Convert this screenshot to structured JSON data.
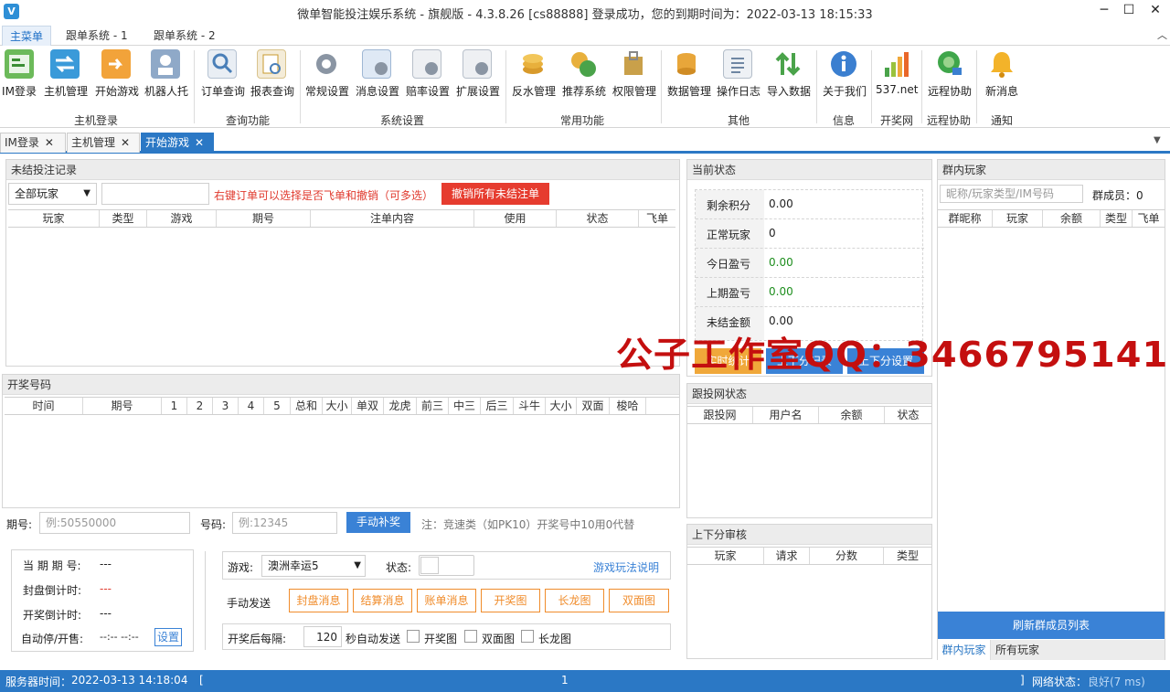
{
  "window": {
    "title": "微单智能投注娱乐系统 - 旗舰版 - 4.3.8.26    [cs88888] 登录成功，您的到期时间为：2022-03-13 18:15:33",
    "app_icon": "V"
  },
  "menu": {
    "tabs": [
      "主菜单",
      "跟单系统 - 1",
      "跟单系统 - 2"
    ]
  },
  "ribbon": {
    "buttons": [
      {
        "label": "IM登录",
        "icon": "im-login-icon"
      },
      {
        "label": "主机管理",
        "icon": "host-manage-icon"
      },
      {
        "label": "开始游戏",
        "icon": "start-game-icon"
      },
      {
        "label": "机器人托",
        "icon": "robot-icon"
      },
      {
        "label": "订单查询",
        "icon": "order-query-icon"
      },
      {
        "label": "报表查询",
        "icon": "report-query-icon"
      },
      {
        "label": "常规设置",
        "icon": "gear-icon"
      },
      {
        "label": "消息设置",
        "icon": "message-settings-icon"
      },
      {
        "label": "赔率设置",
        "icon": "odds-settings-icon"
      },
      {
        "label": "扩展设置",
        "icon": "extension-settings-icon"
      },
      {
        "label": "反水管理",
        "icon": "rebate-icon"
      },
      {
        "label": "推荐系统",
        "icon": "referral-icon"
      },
      {
        "label": "权限管理",
        "icon": "permission-icon"
      },
      {
        "label": "数据管理",
        "icon": "database-icon"
      },
      {
        "label": "操作日志",
        "icon": "log-icon"
      },
      {
        "label": "导入数据",
        "icon": "import-icon"
      },
      {
        "label": "关于我们",
        "icon": "info-icon"
      },
      {
        "label": "537.net",
        "icon": "bar-chart-icon"
      },
      {
        "label": "远程协助",
        "icon": "remote-icon"
      },
      {
        "label": "新消息",
        "icon": "bell-icon"
      }
    ],
    "groups": [
      "主机登录",
      "查询功能",
      "系统设置",
      "常用功能",
      "其他",
      "信息",
      "开奖网",
      "远程协助",
      "通知"
    ]
  },
  "doc_tabs": [
    "IM登录",
    "主机管理",
    "开始游戏"
  ],
  "unsettled": {
    "title": "未结投注记录",
    "filter": "全部玩家",
    "hint": "右键订单可以选择是否飞单和撤销（可多选）",
    "cancel_all": "撤销所有未结注单",
    "columns": [
      "玩家",
      "类型",
      "游戏",
      "期号",
      "注单内容",
      "使用",
      "状态",
      "飞单"
    ]
  },
  "lottery": {
    "title": "开奖号码",
    "columns": [
      "时间",
      "期号",
      "1",
      "2",
      "3",
      "4",
      "5",
      "总和",
      "大小",
      "单双",
      "龙虎",
      "前三",
      "中三",
      "后三",
      "斗牛",
      "大小",
      "双面",
      "梭哈"
    ],
    "period_label": "期号:",
    "period_placeholder": "例:50550000",
    "number_label": "号码:",
    "number_placeholder": "例:12345",
    "manual_button": "手动补奖",
    "note": "注：竞速类（如PK10）开奖号中10用0代替"
  },
  "period_info": {
    "current_label": "当 期 期 号:",
    "current_value": "---",
    "close_label": "封盘倒计时:",
    "close_value": "---",
    "draw_label": "开奖倒计时:",
    "draw_value": "---",
    "auto_label": "自动停/开售:",
    "auto_value": "--:-- --:--",
    "set_button": "设置"
  },
  "game_ctrl": {
    "game_label": "游戏:",
    "game_value": "澳洲幸运5",
    "state_label": "状态:",
    "rules_link": "游戏玩法说明",
    "manual_label": "手动发送",
    "buttons": [
      "封盘消息",
      "结算消息",
      "账单消息",
      "开奖图",
      "长龙图",
      "双面图"
    ],
    "interval_label": "开奖后每隔:",
    "interval_value": "120",
    "auto_label": "秒自动发送",
    "checks": [
      "开奖图",
      "双面图",
      "长龙图"
    ]
  },
  "status": {
    "title": "当前状态",
    "rows": [
      {
        "k": "剩余积分",
        "v": "0.00"
      },
      {
        "k": "正常玩家",
        "v": "0"
      },
      {
        "k": "今日盈亏",
        "v": "0.00"
      },
      {
        "k": "上期盈亏",
        "v": "0.00"
      },
      {
        "k": "未结金额",
        "v": "0.00"
      }
    ],
    "buttons": [
      "实时统计",
      "上下分记录",
      "上下分设置"
    ]
  },
  "follow": {
    "title": "跟投网状态",
    "columns": [
      "跟投网",
      "用户名",
      "余额",
      "状态"
    ]
  },
  "audit": {
    "title": "上下分审核",
    "columns": [
      "玩家",
      "请求",
      "分数",
      "类型"
    ]
  },
  "group": {
    "title": "群内玩家",
    "search_placeholder": "昵称/玩家类型/IM号码",
    "member_label": "群成员：",
    "member_count": "0",
    "columns": [
      "群昵称",
      "玩家",
      "余额",
      "类型",
      "飞单"
    ],
    "refresh": "刷新群成员列表",
    "tabs": [
      "群内玩家",
      "所有玩家"
    ]
  },
  "statusbar": {
    "server_time_label": "服务器时间：",
    "server_time": "2022-03-13 14:18:04",
    "left_bracket": "[",
    "center": "1",
    "right_bracket": "]",
    "net_label": "网络状态：",
    "net_value": "良好(7 ms)"
  },
  "watermark": "公子工作室QQ：3466795141",
  "colors": {
    "accent": "#2b78c5",
    "danger": "#e63c2f",
    "orange": "#f08c2b",
    "green": "#1e8e1e"
  }
}
